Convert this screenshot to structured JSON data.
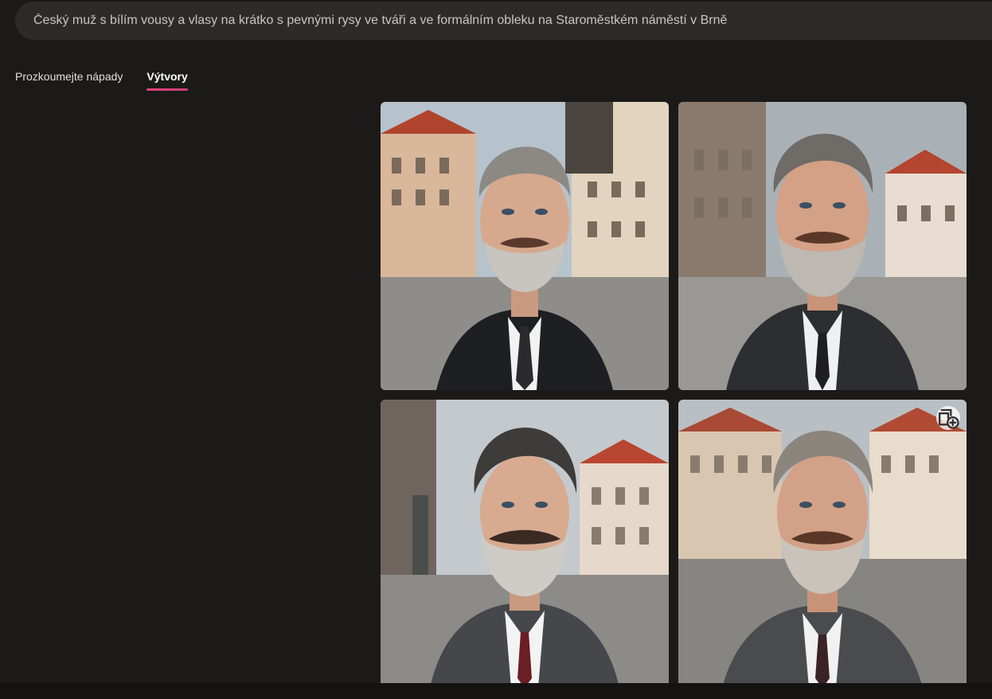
{
  "search": {
    "value": "Český muž s bílím vousy a vlasy na krátko s pevnými rysy ve tváři a ve formálním obleku na Staroměstkém náměstí v Brně"
  },
  "tabs": [
    {
      "label": "Prozkoumejte nápady",
      "active": false
    },
    {
      "label": "Výtvory",
      "active": true
    }
  ],
  "images": [
    {
      "icon": "generated-image"
    },
    {
      "icon": "generated-image"
    },
    {
      "icon": "generated-image"
    },
    {
      "icon": "generated-image",
      "action_icon": "add-to-collection-icon"
    }
  ],
  "colors": {
    "background": "#1b1a19",
    "search_bg": "#2c2b2a",
    "tab_accent": "#e4407a"
  }
}
